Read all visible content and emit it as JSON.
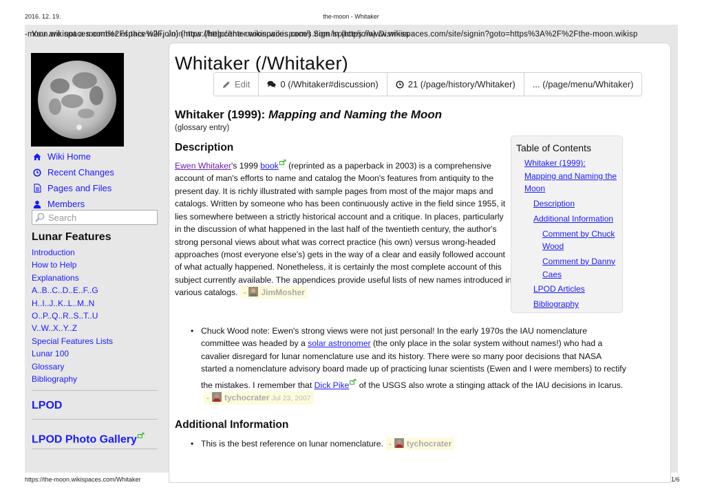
{
  "print_header": {
    "date": "2016. 12. 19.",
    "title": "the-moon - Whitaker"
  },
  "print_footer": {
    "url": "https://the-moon.wikispaces.com/Whitaker",
    "page": "1/6"
  },
  "overlapping_banner": {
    "layer_a": "-moon.wikispaces.com%2Fspace%2Fjoin)  (https://helpcenter.wikispaces.com/) Sign In (https://www.wikispaces.com/site/signin?goto=https%3A%2F%2Fthe-moon.wikisp",
    "layer_b": "You are not a member of this wiki.  Join now  (http://the-moon.wikispaces.com/space/join)  Dismiss",
    "visible_right": "Sign In (https://www.wikispaces.com/site/signin?goto=https%3A%2F%2Fthe-moon.wikisp"
  },
  "sidebar": {
    "logo_alt": "Full Moon",
    "nav": [
      {
        "icon": "home-icon",
        "label": "Wiki Home"
      },
      {
        "icon": "clock-icon",
        "label": "Recent Changes"
      },
      {
        "icon": "document-icon",
        "label": "Pages and Files"
      },
      {
        "icon": "user-icon",
        "label": "Members"
      }
    ],
    "search_placeholder": "Search",
    "lunar_heading": "Lunar Features",
    "lunar_links": [
      "Introduction",
      "How to Help",
      "Explanations",
      "A..B..C..D..E..F..G",
      "H..I..J..K..L..M..N",
      "O..P..Q..R..S..T..U",
      "V..W..X..Y..Z",
      "Special Features Lists",
      "Lunar 100",
      "Glossary",
      "Bibliography"
    ],
    "lpod": "LPOD",
    "lpod_gallery": "LPOD Photo Gallery"
  },
  "page": {
    "title": "Whitaker (/Whitaker)",
    "toolbar": {
      "edit": "Edit",
      "discussion": "0 (/Whitaker#discussion)",
      "history": "21 (/page/history/Whitaker)",
      "menu": "... (/page/menu/Whitaker)"
    },
    "heading": {
      "prefix": "Whitaker (1999): ",
      "italic": "Mapping and Naming the Moon"
    },
    "glossary_note": "(glossary entry)",
    "description": {
      "heading": "Description",
      "author_link": "Ewen Whitaker",
      "text_1": "'s 1999 ",
      "book_link": "book",
      "text_2": " (reprinted as a paperback in 2003) is a comprehensive account of man's efforts to name and catalog the Moon's features from antiquity to the present day. It is richly illustrated with sample pages from most of the major maps and catalogs. Written by someone who has been continuously active in the field since 1955, it lies somewhere between a strictly historical account and a critique. In places, particularly in the discussion of what happened in the last half of the twentieth century, the author's strong personal views about what was correct practice (his own) versus wrong-headed approaches (most everyone else's) gets in the way of a clear and easily followed account of what actually happened. Nonetheless, it is certainly the most complete account of this subject currently available. The appendices provide useful lists of new names introduced in various catalogs.",
      "attribution": {
        "dash": "-",
        "user": "JimMosher"
      }
    },
    "comment_chuck": {
      "text_1": "Chuck Wood note: Ewen's strong views were not just personal! In the early 1970s the IAU nomenclature committee was headed by a ",
      "link_1": "solar astronomer",
      "text_2": " (the only place in the solar system without names!) who had a cavalier disregard for lunar nomenclature use and its history. There were so many poor decisions that NASA started a nomenclature advisory board made up of practicing lunar scientists (Ewen and I were members) to rectify the mistakes. I remember that ",
      "link_2": "Dick Pike",
      "text_3": " of the USGS also wrote a stinging attack of the IAU decisions in Icarus.",
      "attribution": {
        "dash": "-",
        "user": "tychocrater",
        "date": "Jul 23, 2007"
      }
    },
    "additional": {
      "heading": "Additional Information",
      "item": "This is the best reference on lunar nomenclature.",
      "attribution": {
        "dash": "-",
        "user": "tychocrater"
      }
    },
    "toc": {
      "title": "Table of Contents",
      "items": [
        {
          "level": 1,
          "label": "Whitaker (1999): Mapping and Naming the Moon"
        },
        {
          "level": 2,
          "label": "Description"
        },
        {
          "level": 2,
          "label": "Additional Information"
        },
        {
          "level": 3,
          "label": "Comment by Chuck Wood"
        },
        {
          "level": 3,
          "label": "Comment by Danny Caes"
        },
        {
          "level": 2,
          "label": "LPOD Articles"
        },
        {
          "level": 2,
          "label": "Bibliography"
        }
      ]
    }
  },
  "colors": {
    "link": "#1a1aff",
    "visited_link": "#6a1ab0",
    "sidebar_bg": "#e7e7e7",
    "attribution_bg": "#fdfbdc",
    "toc_bg": "#f2f2f2",
    "external_icon": "#2db32d"
  }
}
